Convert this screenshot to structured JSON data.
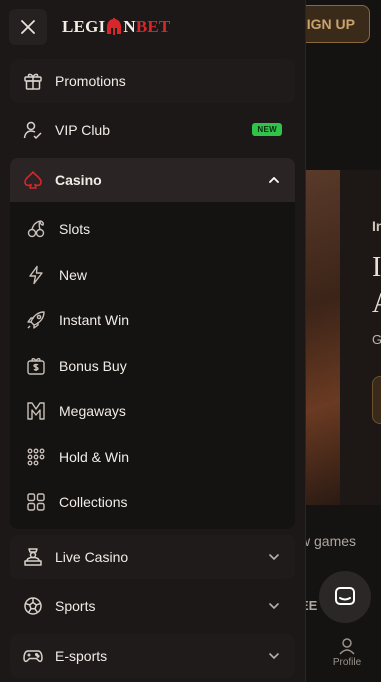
{
  "background": {
    "signup_label": "IGN UP",
    "hero_title_char": "In",
    "hero_line1": "I",
    "hero_line2": "A",
    "hero_sub": "G",
    "games_text": "w games",
    "see_text": "EE",
    "profile_label": "Profile"
  },
  "drawer": {
    "logo": {
      "part1": "LEGI",
      "part2": "N",
      "part3": "BET"
    },
    "items": [
      {
        "label": "Promotions",
        "icon": "gift-icon"
      },
      {
        "label": "VIP Club",
        "icon": "vip-user-icon",
        "badge": "NEW"
      },
      {
        "label": "Casino",
        "icon": "spade-icon",
        "expanded": true
      }
    ],
    "casino_subitems": [
      {
        "label": "Slots",
        "icon": "cherries-icon"
      },
      {
        "label": "New",
        "icon": "lightning-icon"
      },
      {
        "label": "Instant Win",
        "icon": "rocket-icon"
      },
      {
        "label": "Bonus Buy",
        "icon": "dollar-gift-icon"
      },
      {
        "label": "Megaways",
        "icon": "megaways-icon"
      },
      {
        "label": "Hold & Win",
        "icon": "dots-grid-icon"
      },
      {
        "label": "Collections",
        "icon": "squares-grid-icon"
      }
    ],
    "bottom_items": [
      {
        "label": "Live Casino",
        "icon": "dealer-icon"
      },
      {
        "label": "Sports",
        "icon": "soccer-ball-icon"
      },
      {
        "label": "E-sports",
        "icon": "gamepad-icon"
      }
    ]
  },
  "colors": {
    "accent_red": "#d8262b",
    "badge_green": "#2fc34a",
    "drawer_bg": "#1c1818"
  }
}
